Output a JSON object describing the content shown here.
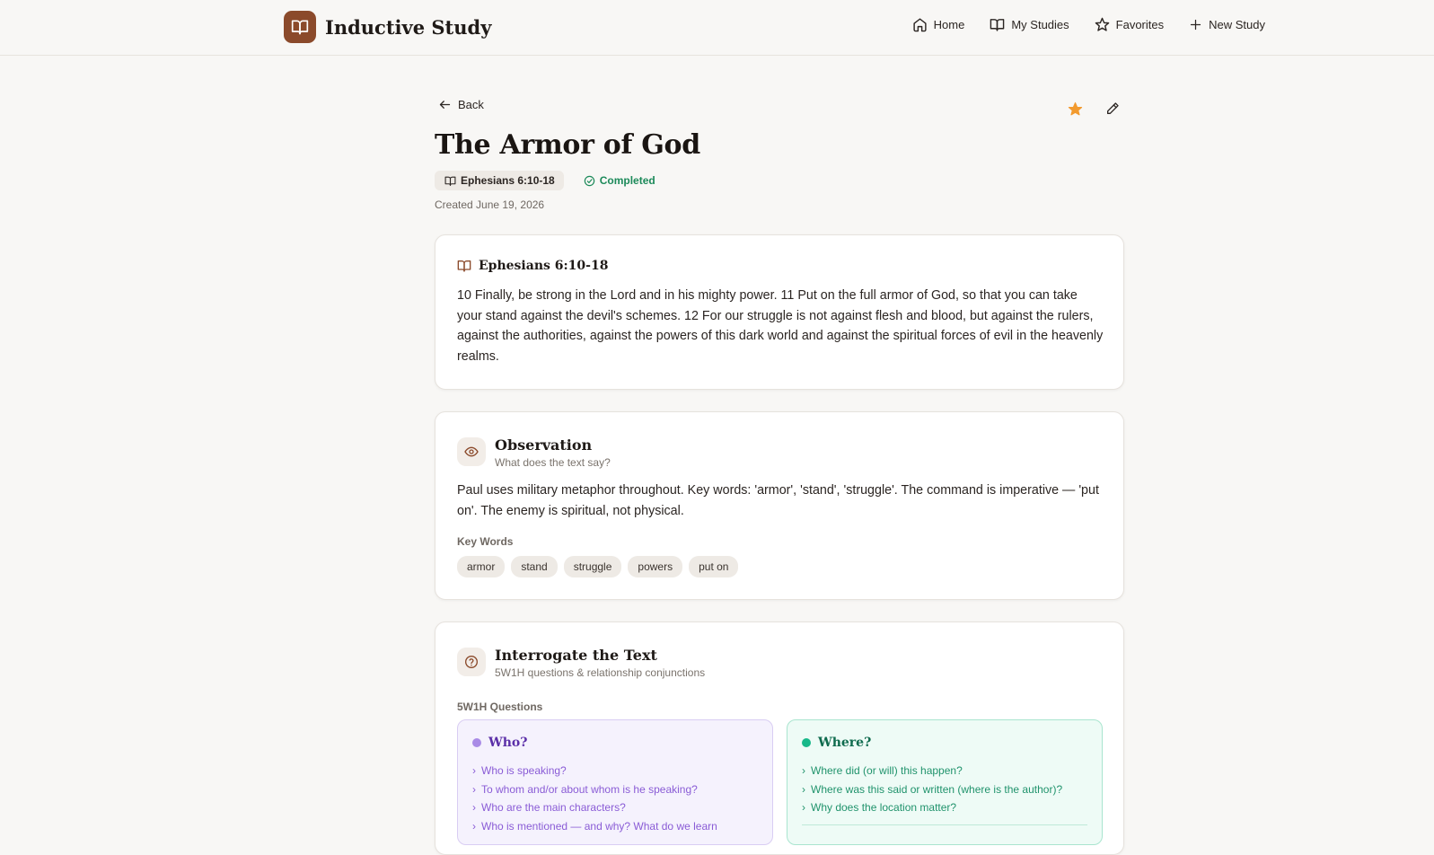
{
  "app": {
    "name": "Inductive Study",
    "logo_icon": "book-open-icon",
    "accent": "#8b4a2b"
  },
  "nav": {
    "items": [
      {
        "label": "Home",
        "icon": "home-icon"
      },
      {
        "label": "My Studies",
        "icon": "book-open-icon"
      },
      {
        "label": "Favorites",
        "icon": "star-icon"
      },
      {
        "label": "New Study",
        "icon": "plus-icon"
      }
    ]
  },
  "study": {
    "back_label": "Back",
    "title": "The Armor of God",
    "reference": "Ephesians 6:10-18",
    "status": "Completed",
    "status_color": "#1d8a5a",
    "created": "Created June 19, 2026",
    "favorite": true,
    "favorite_color": "#f29a2e"
  },
  "scripture": {
    "reference": "Ephesians 6:10-18",
    "text": "10 Finally, be strong in the Lord and in his mighty power. 11 Put on the full armor of God, so that you can take your stand against the devil's schemes. 12 For our struggle is not against flesh and blood, but against the rulers, against the authorities, against the powers of this dark world and against the spiritual forces of evil in the heavenly realms."
  },
  "observation": {
    "title": "Observation",
    "subtitle": "What does the text say?",
    "text": "Paul uses military metaphor throughout. Key words: 'armor', 'stand', 'struggle'. The command is imperative — 'put on'. The enemy is spiritual, not physical.",
    "key_words_label": "Key Words",
    "key_words": [
      "armor",
      "stand",
      "struggle",
      "powers",
      "put on"
    ]
  },
  "interrogate": {
    "title": "Interrogate the Text",
    "subtitle": "5W1H questions & relationship conjunctions",
    "questions_label": "5W1H Questions",
    "who": {
      "title": "Who?",
      "color": "#a98be6",
      "items": [
        "Who is speaking?",
        "To whom and/or about whom is he speaking?",
        "Who are the main characters?",
        "Who is mentioned — and why? What do we learn"
      ]
    },
    "where": {
      "title": "Where?",
      "color": "#17b889",
      "items": [
        "Where did (or will) this happen?",
        "Where was this said or written (where is the author)?",
        "Why does the location matter?"
      ]
    }
  }
}
